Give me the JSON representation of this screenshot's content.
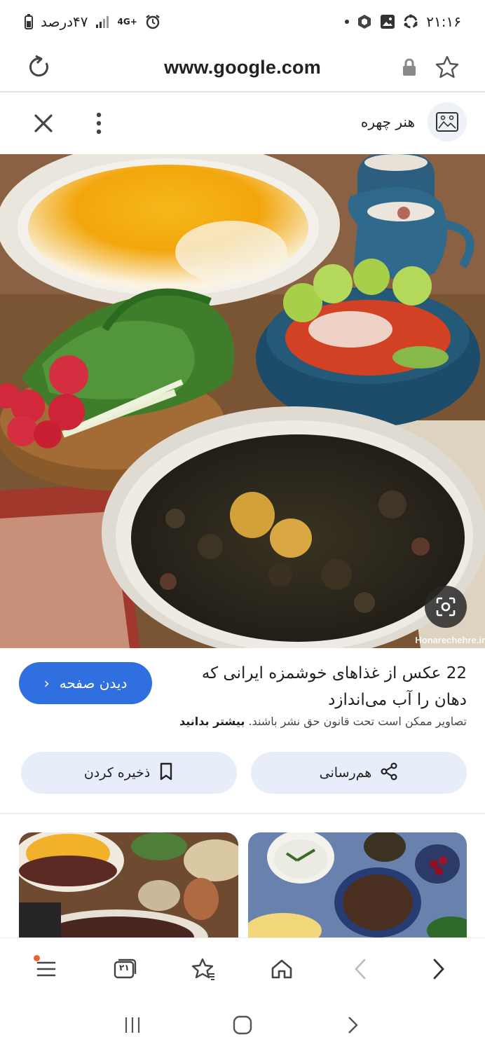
{
  "status_bar": {
    "battery_text": "۴۷درصد",
    "network_label": "4G+",
    "time": "۲۱:۱۶"
  },
  "browser": {
    "url": "www.google.com"
  },
  "lens_header": {
    "site_name": "هنر چهره"
  },
  "hero": {
    "watermark": "Honarechehre.ir"
  },
  "result": {
    "title": "22 عکس از غذاهای خوشمزه ایرانی که دهان را آب می‌اندازد",
    "visit_label": "دیدن صفحه",
    "copyright_text": "تصاویر ممکن است تحت قانون حق نشر باشند.",
    "learn_more": "بیشتر بدانید",
    "share_label": "هم‌رسانی",
    "save_label": "ذخیره کردن"
  },
  "toolbar": {
    "tabs_count": "۲۱"
  },
  "colors": {
    "accent": "#2f6fdf",
    "action_bg": "#e8eef9",
    "notification_dot": "#e8623a"
  }
}
